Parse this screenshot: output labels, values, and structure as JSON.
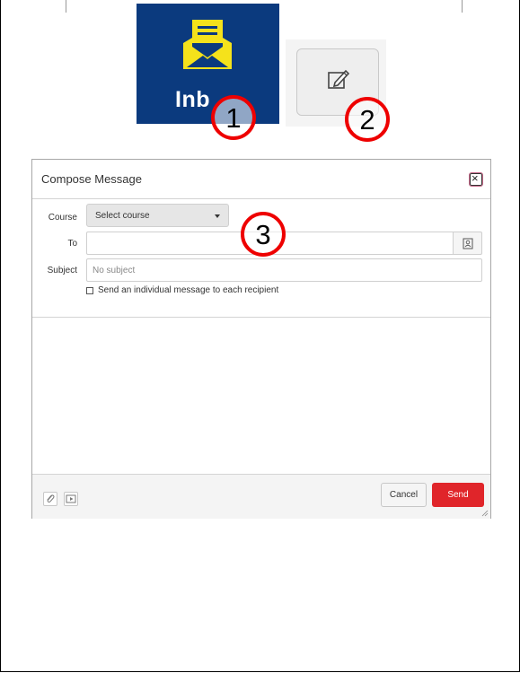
{
  "inbox_tile": {
    "label": "Inb"
  },
  "callouts": {
    "one": "1",
    "two": "2",
    "three": "3"
  },
  "dialog": {
    "title": "Compose Message",
    "close_glyph": "×",
    "course_label": "Course",
    "course_select": "Select course",
    "to_label": "To",
    "subject_label": "Subject",
    "subject_placeholder": "No subject",
    "individual_label": "Send an individual message to each recipient",
    "cancel": "Cancel",
    "send": "Send"
  },
  "colors": {
    "inbox_bg": "#0b3a7e",
    "inbox_icon": "#f5e21b",
    "send_bg": "#e0252a",
    "callout": "#ee0000"
  },
  "icons": [
    "envelope-icon",
    "compose-icon",
    "close-icon",
    "address-book-icon",
    "attachment-icon",
    "media-icon",
    "resize-grip-icon"
  ]
}
